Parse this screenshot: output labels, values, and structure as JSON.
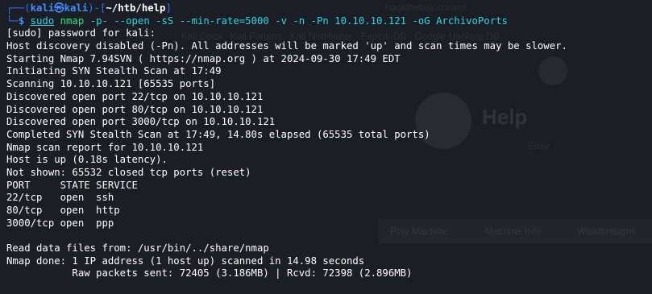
{
  "background_page": {
    "url_fragment": "hackthebox.com/m",
    "bookmarks": "Kali Docs   Kali Forums   Kali NetHunter   Exploit-DB   Google Hacking DB",
    "machine_title": "Help",
    "difficulty": "Easy",
    "tabs": [
      "Play Machine",
      "Machine Info",
      "Walkthroughs"
    ]
  },
  "prompt": {
    "user": "kali",
    "separator": "㉿",
    "host": "kali",
    "path": "~/htb/help",
    "corner_top": "┌──",
    "corner_bottom": "└─",
    "dollar": "$"
  },
  "command": {
    "sudo": "sudo",
    "program": "nmap",
    "args": "-p- --open -sS --min-rate=5000 -v -n -Pn 10.10.10.121 -oG ArchivoPorts"
  },
  "output_lines": [
    "[sudo] password for kali:",
    "Host discovery disabled (-Pn). All addresses will be marked 'up' and scan times may be slower.",
    "Starting Nmap 7.94SVN ( https://nmap.org ) at 2024-09-30 17:49 EDT",
    "Initiating SYN Stealth Scan at 17:49",
    "Scanning 10.10.10.121 [65535 ports]",
    "Discovered open port 22/tcp on 10.10.10.121",
    "Discovered open port 80/tcp on 10.10.10.121",
    "Discovered open port 3000/tcp on 10.10.10.121",
    "Completed SYN Stealth Scan at 17:49, 14.80s elapsed (65535 total ports)",
    "Nmap scan report for 10.10.10.121",
    "Host is up (0.18s latency).",
    "Not shown: 65532 closed tcp ports (reset)",
    "PORT     STATE SERVICE",
    "22/tcp   open  ssh",
    "80/tcp   open  http",
    "3000/tcp open  ppp",
    "",
    "Read data files from: /usr/bin/../share/nmap",
    "Nmap done: 1 IP address (1 host up) scanned in 14.98 seconds",
    "           Raw packets sent: 72405 (3.186MB) | Rcvd: 72398 (2.896MB)"
  ],
  "colors": {
    "background": "#1c1e26",
    "prompt_blue": "#2d70ff",
    "command_green": "#2fe07e",
    "arg_cyan": "#27d7e8",
    "text": "#ffffff"
  }
}
